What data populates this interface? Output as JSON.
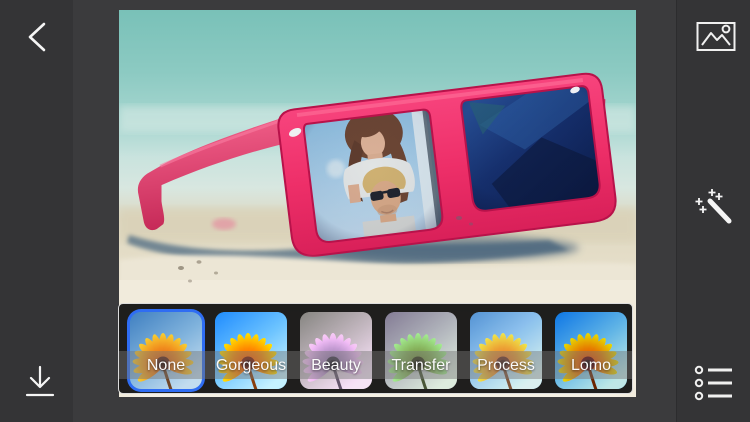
{
  "colors": {
    "accent_blue": "#2f6df3",
    "frame_pink": "#ee2f69",
    "sidebar_bg": "#343436",
    "canvas_bg": "#3b3b3d",
    "strip_bg": "#0e0e0e"
  },
  "left_toolbar": {
    "buttons": [
      {
        "id": "back",
        "icon": "chevron-left-icon"
      },
      {
        "id": "save",
        "icon": "download-icon"
      }
    ]
  },
  "right_toolbar": {
    "buttons": [
      {
        "id": "gallery",
        "icon": "photo-icon"
      },
      {
        "id": "effects",
        "icon": "magic-wand-icon"
      },
      {
        "id": "frames",
        "icon": "list-icon"
      }
    ]
  },
  "photo": {
    "description": "Pink wayfarer sunglasses lying on white beach sand under a teal sky; a photo of a couple (woman embracing a blond man wearing sunglasses) appears inside the left lens; the right lens is reflective dark blue"
  },
  "filter_bar": {
    "selected": "None",
    "filters": [
      {
        "label": "None",
        "selected": true
      },
      {
        "label": "Gorgeous",
        "selected": false
      },
      {
        "label": "Beauty",
        "selected": false
      },
      {
        "label": "Transfer",
        "selected": false
      },
      {
        "label": "Process",
        "selected": false
      },
      {
        "label": "Lomo",
        "selected": false
      }
    ]
  }
}
